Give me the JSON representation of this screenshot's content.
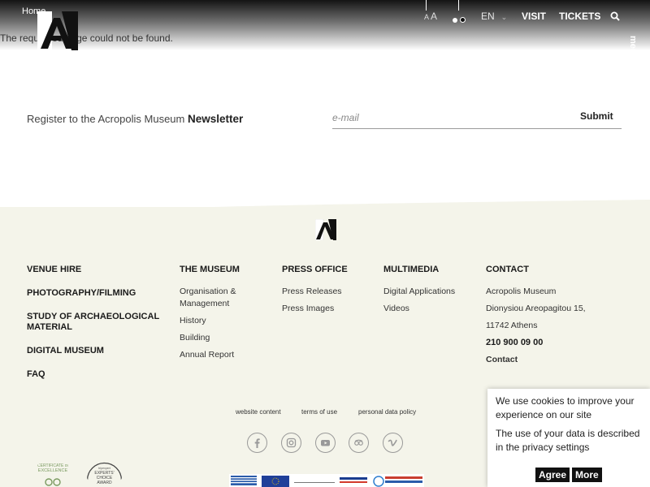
{
  "breadcrumb": {
    "home": "Home"
  },
  "header": {
    "font_size": {
      "small": "A",
      "large": "A"
    },
    "language": "EN",
    "visit": "VISIT",
    "tickets": "TICKETS",
    "menu": "menu"
  },
  "main": {
    "not_found": "The requested page could not be found."
  },
  "newsletter": {
    "prefix": "Register to the Acropolis Museum",
    "emphasis": "Newsletter",
    "email_placeholder": "e-mail",
    "submit": "Submit"
  },
  "footer": {
    "col1": [
      "VENUE HIRE",
      "PHOTOGRAPHY/FILMING",
      "STUDY OF ARCHAEOLOGICAL MATERIAL",
      "DIGITAL MUSEUM",
      "FAQ"
    ],
    "museum": {
      "title": "THE MUSEUM",
      "links": [
        "Organisation & Management",
        "History",
        "Building",
        "Annual Report"
      ]
    },
    "press": {
      "title": "PRESS OFFICE",
      "links": [
        "Press Releases",
        "Press Images"
      ]
    },
    "multimedia": {
      "title": "MULTIMEDIA",
      "links": [
        "Digital Applications",
        "Videos"
      ]
    },
    "contact": {
      "title": "CONTACT",
      "name": "Acropolis Museum",
      "street": "Dionysiou Areopagitou 15,",
      "city": "11742 Athens",
      "phone": "210 900 09 00",
      "link": "Contact"
    },
    "legal": [
      "website content",
      "terms of use",
      "personal data policy"
    ],
    "social_icons": [
      "facebook-icon",
      "instagram-icon",
      "youtube-icon",
      "tripadvisor-icon",
      "vimeo-icon"
    ]
  },
  "cookie": {
    "line1": "We use cookies to improve your experience on our site",
    "line2": "The use of your data is described in the privacy settings",
    "agree": "Agree",
    "more": "More"
  },
  "colors": {
    "footer_bg": "#f4f4ea",
    "button_bg": "#111111",
    "text": "#2b2b2b"
  }
}
